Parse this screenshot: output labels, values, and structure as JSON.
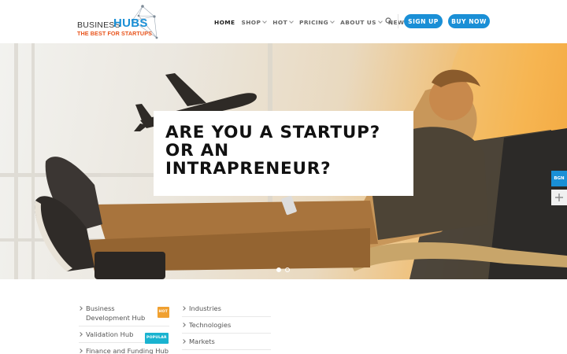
{
  "logo": {
    "word1": "BUSINESS",
    "word2": "HUBS",
    "tagline": "THE BEST FOR STARTUPS"
  },
  "nav": {
    "items": [
      {
        "label": "HOME",
        "active": true,
        "dropdown": false
      },
      {
        "label": "SHOP",
        "active": false,
        "dropdown": true
      },
      {
        "label": "HOT",
        "active": false,
        "dropdown": true
      },
      {
        "label": "PRICING",
        "active": false,
        "dropdown": true
      },
      {
        "label": "ABOUT US",
        "active": false,
        "dropdown": true
      },
      {
        "label": "NEWS",
        "active": false,
        "dropdown": false
      }
    ],
    "signup_label": "SIGN UP",
    "buy_label": "BUY NOW"
  },
  "hero": {
    "line1": "ARE YOU A STARTUP?",
    "line2": "OR AN",
    "line3": "INTRAPRENEUR?",
    "slide_count": 2,
    "active_slide": 1
  },
  "side": {
    "badge_label": "BGN"
  },
  "footer": {
    "col1": [
      {
        "label": "Business Development Hub",
        "badge": "HOT"
      },
      {
        "label": "Validation Hub",
        "badge": "POPULAR"
      },
      {
        "label": "Finance and Funding Hub",
        "badge": ""
      }
    ],
    "col2": [
      {
        "label": "Industries"
      },
      {
        "label": "Technologies"
      },
      {
        "label": "Markets"
      }
    ]
  },
  "colors": {
    "accent": "#1a8fd6",
    "logo_orange": "#e8541c",
    "hot_badge": "#f0a030",
    "popular_badge": "#1ab3d0"
  }
}
